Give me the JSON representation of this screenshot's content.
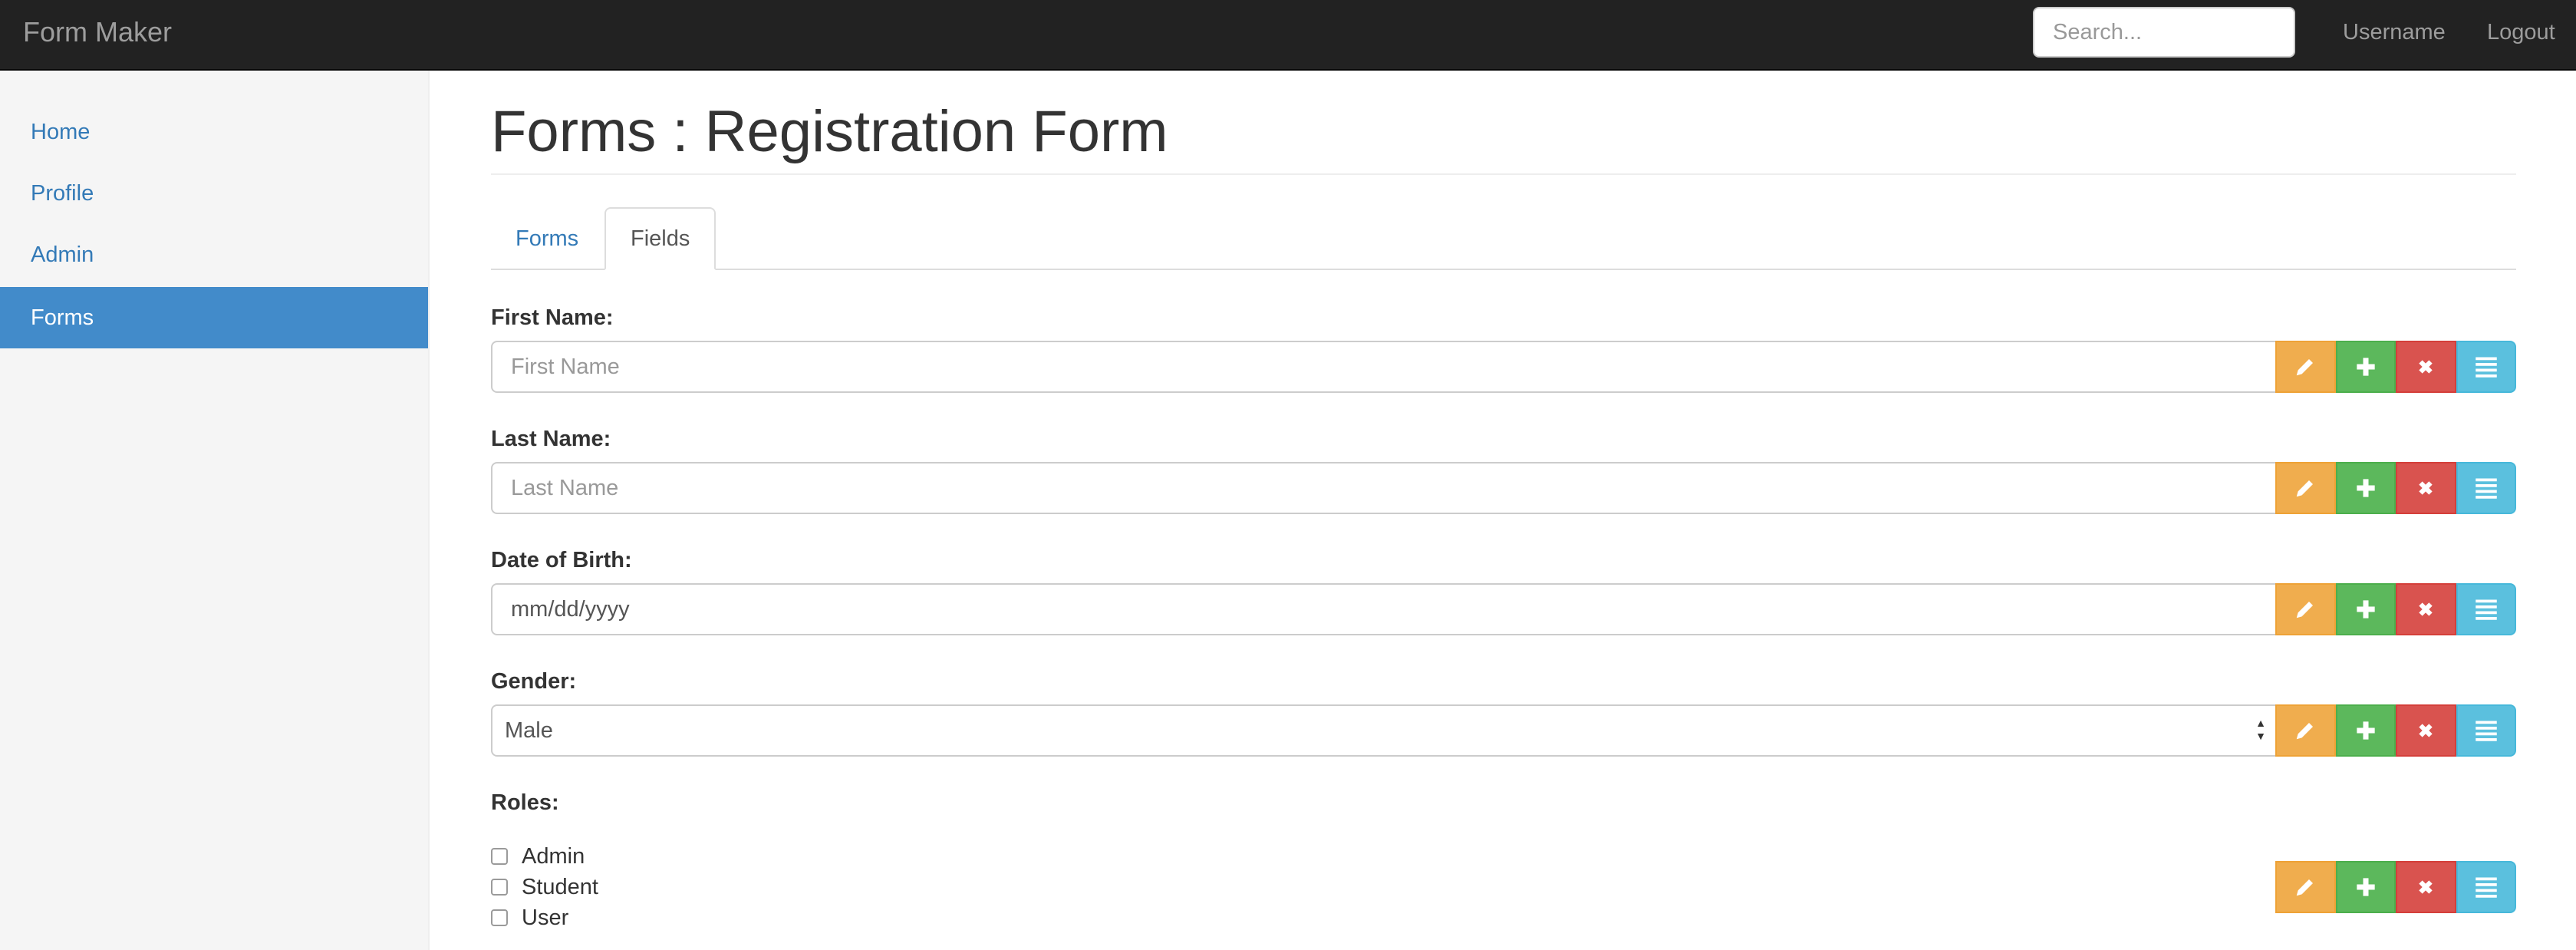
{
  "navbar": {
    "brand": "Form Maker",
    "search_placeholder": "Search...",
    "username": "Username",
    "logout": "Logout"
  },
  "sidebar": {
    "items": [
      {
        "label": "Home"
      },
      {
        "label": "Profile"
      },
      {
        "label": "Admin"
      },
      {
        "label": "Forms",
        "active": true
      }
    ]
  },
  "main": {
    "title": "Forms : Registration Form",
    "tabs": [
      {
        "label": "Forms"
      },
      {
        "label": "Fields",
        "active": true
      }
    ],
    "fields": [
      {
        "label": "First Name:",
        "type": "text",
        "placeholder": "First Name"
      },
      {
        "label": "Last Name:",
        "type": "text",
        "placeholder": "Last Name"
      },
      {
        "label": "Date of Birth:",
        "type": "date",
        "value": "mm/dd/yyyy"
      },
      {
        "label": "Gender:",
        "type": "select",
        "value": "Male"
      },
      {
        "label": "Roles:",
        "type": "checkbox",
        "options": [
          "Admin",
          "Student",
          "User"
        ]
      }
    ],
    "actions": {
      "edit": "pencil-icon",
      "add": "plus-icon",
      "delete": "close-icon",
      "reorder": "list-icon"
    }
  },
  "colors": {
    "navbar": "#222222",
    "sidebar_active": "#428bca",
    "link": "#337ab7",
    "warning": "#f0ad4e",
    "success": "#5cb85c",
    "danger": "#d9534f",
    "info": "#5bc0de"
  }
}
